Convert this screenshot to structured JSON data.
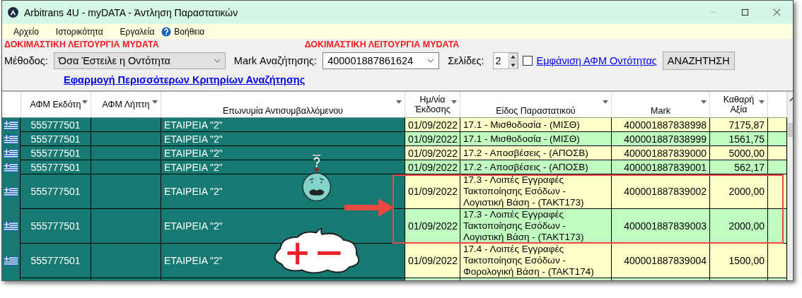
{
  "window": {
    "title": "Arbitrans 4U - myDATA - Άντληση Παραστατικών"
  },
  "menu": [
    {
      "label": "Αρχείο",
      "kind": "plain"
    },
    {
      "label": "Ιστορικότητα",
      "kind": "plain"
    },
    {
      "label": "Εργαλεία",
      "kind": "plain"
    },
    {
      "label": "Βοήθεια",
      "kind": "help"
    }
  ],
  "banners": [
    "ΔΟΚΙΜΑΣΤΙΚΗ ΛΕΙΤΟΥΡΓΙΑ MYDATA",
    "ΔΟΚΙΜΑΣΤΙΚΗ ΛΕΙΤΟΥΡΓΙΑ MYDATA"
  ],
  "filters": {
    "method_label": "Μέθοδος:",
    "method_value": "Όσα Έστειλε η Οντότητα",
    "mark_label": "Mark Αναζήτησης:",
    "mark_value": "400001887861624",
    "pages_label": "Σελίδες:",
    "pages_value": "2",
    "show_vat": {
      "label": "Εμφάνιση ΑΦΜ Οντότητας",
      "checked": false
    },
    "more_criteria_link": "Εφαρμογή Περισσότερων Κριτηρίων Αναζήτησης",
    "search_button": "ΑΝΑΖΗΤΗΣΗ"
  },
  "table": {
    "columns": [
      "ΑΦΜ Εκδότη",
      "ΑΦΜ Λήπτη",
      "Επωνυμία Αντισυμβαλλόμενου",
      "Ημ/νία Έκδοσης",
      "Είδος Παραστατικού",
      "Mark",
      "Καθαρή Αξία"
    ],
    "rows": [
      {
        "issuer_vat": "555777501",
        "name": "ΕΤΑΙΡΕΙΑ \"2\"",
        "date": "01/09/2022",
        "type": "17.1 - Μισθοδοσία - (ΜΙΣΘ)",
        "mark": "400001887838998",
        "net_value": "7175,87",
        "highlighted": false
      },
      {
        "issuer_vat": "555777501",
        "name": "ΕΤΑΙΡΕΙΑ \"2\"",
        "date": "01/09/2022",
        "type": "17.1 - Μισθοδοσία - (ΜΙΣΘ)",
        "mark": "400001887838999",
        "net_value": "1561,75",
        "highlighted": false
      },
      {
        "issuer_vat": "555777501",
        "name": "ΕΤΑΙΡΕΙΑ \"2\"",
        "date": "01/09/2022",
        "type": "17.2 - Αποσβέσεις - (ΑΠΟΣΒ)",
        "mark": "400001887839000",
        "net_value": "5000,00",
        "highlighted": false
      },
      {
        "issuer_vat": "555777501",
        "name": "ΕΤΑΙΡΕΙΑ \"2\"",
        "date": "01/09/2022",
        "type": "17.2 - Αποσβέσεις - (ΑΠΟΣΒ)",
        "mark": "400001887839001",
        "net_value": "562,17",
        "highlighted": false
      },
      {
        "issuer_vat": "555777501",
        "name": "ΕΤΑΙΡΕΙΑ \"2\"",
        "date": "01/09/2022",
        "type": "17.3 - Λοιπές Εγγραφές Τακτοποίησης Εσόδων - Λογιστική Βάση - (ΤΑΚΤ173)",
        "mark": "400001887839002",
        "net_value": "2000,00",
        "highlighted": true
      },
      {
        "issuer_vat": "555777501",
        "name": "ΕΤΑΙΡΕΙΑ \"2\"",
        "date": "01/09/2022",
        "type": "17.3 - Λοιπές Εγγραφές Τακτοποίησης Εσόδων - Λογιστική Βάση - (ΤΑΚΤ173)",
        "mark": "400001887839003",
        "net_value": "2000,00",
        "highlighted": true
      },
      {
        "issuer_vat": "555777501",
        "name": "ΕΤΑΙΡΕΙΑ \"2\"",
        "date": "01/09/2022",
        "type": "17.4 - Λοιπές Εγγραφές Τακτοποίησης Εσόδων - Φορολογική Βάση - (ΤΑΚΤ174)",
        "mark": "400001887839004",
        "net_value": "1500,00",
        "highlighted": false
      }
    ]
  }
}
